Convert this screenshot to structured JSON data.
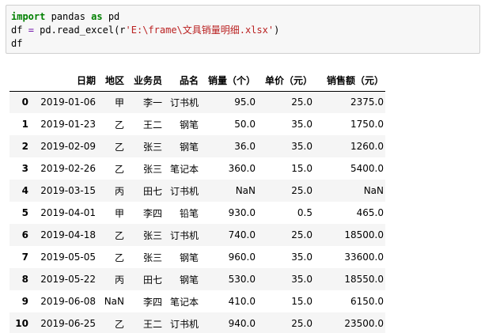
{
  "code": {
    "line1": {
      "kw1": "import",
      "t1": " pandas ",
      "kw2": "as",
      "t2": " pd"
    },
    "line2": {
      "t1": "df ",
      "op": "=",
      "t2": " pd.read_excel(r",
      "str": "'E:\\frame\\文具销量明细.xlsx'",
      "t3": ")"
    },
    "line3": "df"
  },
  "table": {
    "columns": [
      "日期",
      "地区",
      "业务员",
      "品名",
      "销量（个）",
      "单价（元）",
      "销售额（元）"
    ],
    "rows": [
      {
        "index": "0",
        "cells": [
          "2019-01-06",
          "甲",
          "李一",
          "订书机",
          "95.0",
          "25.0",
          "2375.0"
        ]
      },
      {
        "index": "1",
        "cells": [
          "2019-01-23",
          "乙",
          "王二",
          "钢笔",
          "50.0",
          "35.0",
          "1750.0"
        ]
      },
      {
        "index": "2",
        "cells": [
          "2019-02-09",
          "乙",
          "张三",
          "钢笔",
          "36.0",
          "35.0",
          "1260.0"
        ]
      },
      {
        "index": "3",
        "cells": [
          "2019-02-26",
          "乙",
          "张三",
          "笔记本",
          "360.0",
          "15.0",
          "5400.0"
        ]
      },
      {
        "index": "4",
        "cells": [
          "2019-03-15",
          "丙",
          "田七",
          "订书机",
          "NaN",
          "25.0",
          "NaN"
        ]
      },
      {
        "index": "5",
        "cells": [
          "2019-04-01",
          "甲",
          "李四",
          "铅笔",
          "930.0",
          "0.5",
          "465.0"
        ]
      },
      {
        "index": "6",
        "cells": [
          "2019-04-18",
          "乙",
          "张三",
          "订书机",
          "740.0",
          "25.0",
          "18500.0"
        ]
      },
      {
        "index": "7",
        "cells": [
          "2019-05-05",
          "乙",
          "张三",
          "钢笔",
          "960.0",
          "35.0",
          "33600.0"
        ]
      },
      {
        "index": "8",
        "cells": [
          "2019-05-22",
          "丙",
          "田七",
          "钢笔",
          "530.0",
          "35.0",
          "18550.0"
        ]
      },
      {
        "index": "9",
        "cells": [
          "2019-06-08",
          "NaN",
          "李四",
          "笔记本",
          "410.0",
          "15.0",
          "6150.0"
        ]
      },
      {
        "index": "10",
        "cells": [
          "2019-06-25",
          "乙",
          "王二",
          "订书机",
          "940.0",
          "25.0",
          "23500.0"
        ]
      }
    ]
  }
}
